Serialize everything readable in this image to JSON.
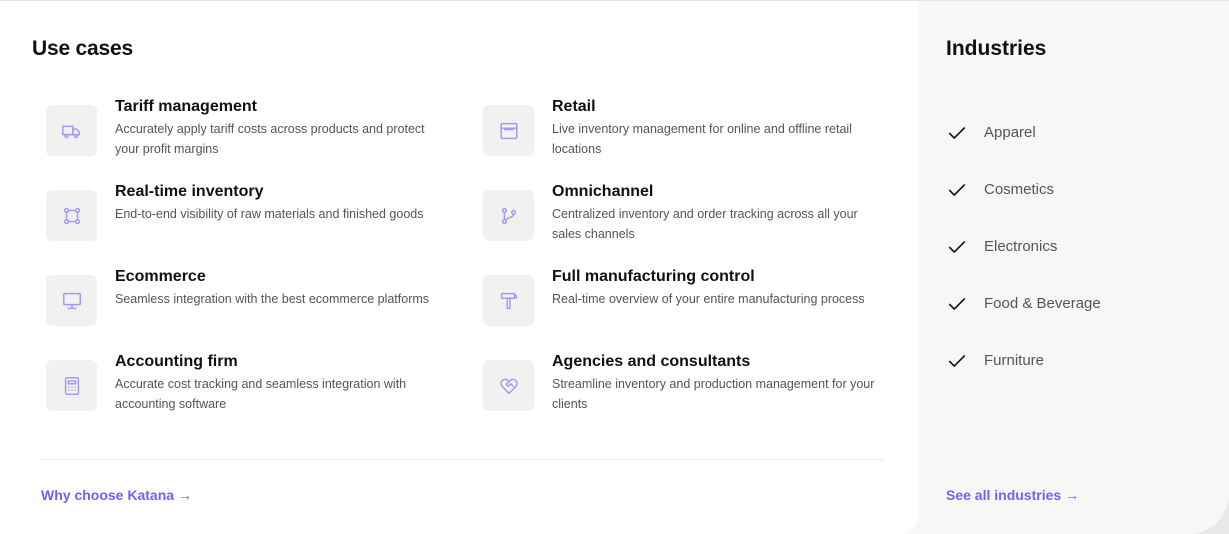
{
  "use_cases": {
    "title": "Use cases",
    "items": [
      {
        "title": "Tariff management",
        "description": "Accurately apply tariff costs across products and protect your profit margins",
        "icon": "truck-icon"
      },
      {
        "title": "Retail",
        "description": "Live inventory management for online and offline retail locations",
        "icon": "store-icon"
      },
      {
        "title": "Real-time inventory",
        "description": "End-to-end visibility of raw materials and finished goods",
        "icon": "square-nodes-icon"
      },
      {
        "title": "Omnichannel",
        "description": "Centralized inventory and order tracking across all your sales channels",
        "icon": "git-branch-icon"
      },
      {
        "title": "Ecommerce",
        "description": "Seamless integration with the best ecommerce platforms",
        "icon": "monitor-icon"
      },
      {
        "title": "Full manufacturing control",
        "description": "Real-time overview of your entire manufacturing process",
        "icon": "hammer-icon"
      },
      {
        "title": "Accounting firm",
        "description": "Accurate cost tracking and seamless integration with accounting software",
        "icon": "calculator-icon"
      },
      {
        "title": "Agencies and consultants",
        "description": "Streamline inventory and production management for your clients",
        "icon": "heart-handshake-icon"
      }
    ],
    "footer_link": "Why choose Katana",
    "arrow": "→"
  },
  "industries": {
    "title": "Industries",
    "items": [
      "Apparel",
      "Cosmetics",
      "Electronics",
      "Food & Beverage",
      "Furniture"
    ],
    "footer_link": "See all industries",
    "arrow": "→"
  },
  "colors": {
    "accent": "#7b5cf0",
    "icon_stroke": "#a896f5",
    "icon_bg": "#f1f1f0",
    "sidebar_bg": "#f7f7f5"
  }
}
